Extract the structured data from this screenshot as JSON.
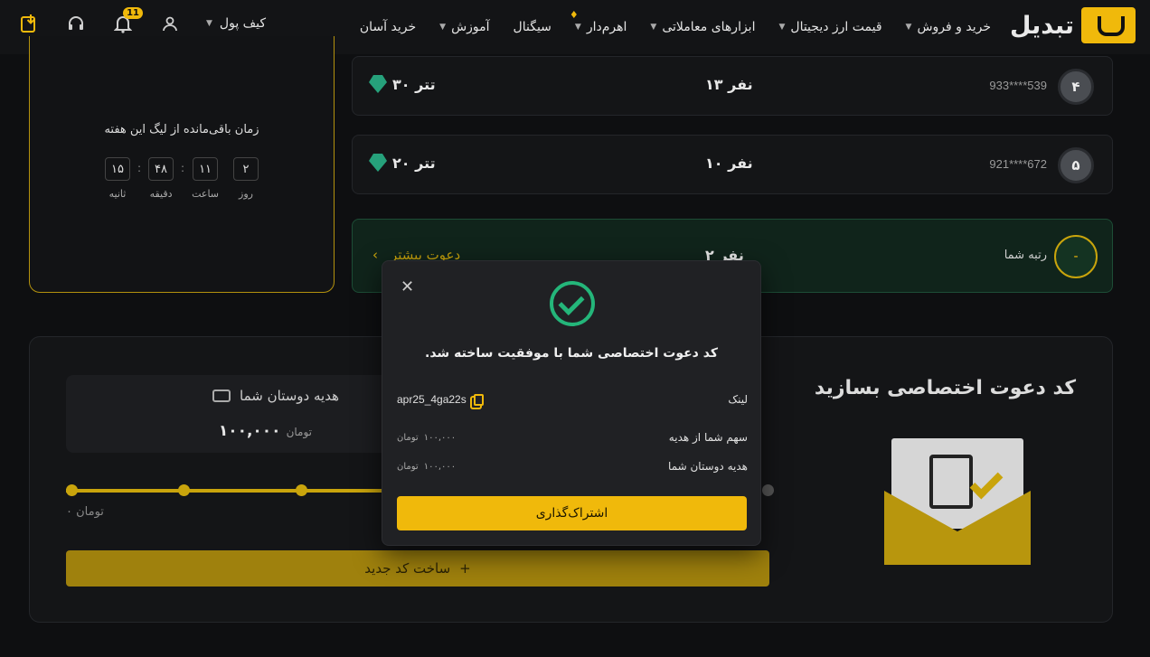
{
  "header": {
    "logo_text": "تبدیل",
    "nav": [
      {
        "label": "خرید و فروش",
        "has_caret": true
      },
      {
        "label": "قیمت ارز دیجیتال",
        "has_caret": true
      },
      {
        "label": "ابزارهای معاملاتی",
        "has_caret": true
      },
      {
        "label": "اهرم‌دار",
        "has_caret": true
      },
      {
        "label": "سیگنال",
        "has_caret": false
      },
      {
        "label": "آموزش",
        "has_caret": true
      },
      {
        "label": "خرید آسان",
        "has_caret": false
      }
    ],
    "wallet_label": "کیف پول",
    "notification_count": "11"
  },
  "timer": {
    "title": "زمان باقی‌مانده از لیگ این هفته",
    "units": [
      {
        "value": "۱۵",
        "label": "ثانیه"
      },
      {
        "value": "۴۸",
        "label": "دقیقه"
      },
      {
        "value": "۱۱",
        "label": "ساعت"
      },
      {
        "value": "۲",
        "label": "روز"
      }
    ]
  },
  "leaderboard": [
    {
      "rank": "۴",
      "phone": "933****539",
      "count": "۱۳ نفر",
      "reward": "۳۰ تتر"
    },
    {
      "rank": "۵",
      "phone": "921****672",
      "count": "۱۰ نفر",
      "reward": "۲۰ تتر"
    }
  ],
  "my_row": {
    "rank": "-",
    "label": "رتبه شما",
    "count": "۲ نفر",
    "invite_more": "دعوت بیشتر"
  },
  "panel": {
    "title": "کد دعوت اختصاصی بسازید",
    "gift_title": "هدیه دوستان شما",
    "gift_amount": "۱۰۰,۰۰۰",
    "gift_unit": "تومان",
    "slider_min_label": "۰ تومان",
    "slider_fraction": 0.45,
    "create_label": "ساخت کد جدید"
  },
  "modal": {
    "title": "کد دعوت اختصاصی شما با موفقیت ساخته شد.",
    "link_label": "لینک",
    "link_value": "apr25_4ga22s",
    "my_share_label": "سهم شما از هدیه",
    "my_share_value": "۱۰۰,۰۰۰",
    "friends_gift_label": "هدیه دوستان شما",
    "friends_gift_value": "۱۰۰,۰۰۰",
    "unit": "تومان",
    "share_label": "اشتراک‌گذاری"
  },
  "colors": {
    "accent": "#f0b90b",
    "success": "#24b67a",
    "tether": "#26a17b"
  }
}
